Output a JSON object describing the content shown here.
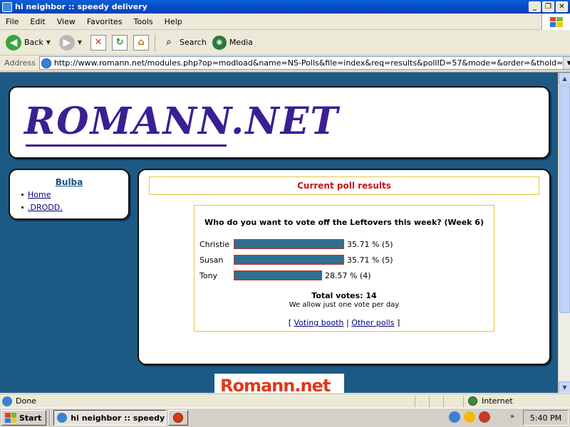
{
  "window": {
    "title": "hi neighbor :: speedy delivery",
    "controls": {
      "minimize": "_",
      "maximize": "❐",
      "close": "✕"
    }
  },
  "menu": [
    "File",
    "Edit",
    "View",
    "Favorites",
    "Tools",
    "Help"
  ],
  "toolbar": {
    "back_label": "Back",
    "search_label": "Search",
    "media_label": "Media"
  },
  "address": {
    "label": "Address",
    "url": "http://www.romann.net/modules.php?op=modload&name=NS-Polls&file=index&req=results&pollID=57&mode=&order=&thold="
  },
  "site": {
    "logo_text": "ROMANN.NET",
    "sidebar": {
      "title": "Bulba",
      "links": [
        "Home",
        ".DRODD."
      ]
    },
    "poll": {
      "heading": "Current poll results",
      "question": "Who do you want to vote off the Leftovers this week? (Week 6)",
      "options": [
        {
          "name": "Christie",
          "percent": 35.71,
          "votes": 5,
          "label": "35.71 % (5)"
        },
        {
          "name": "Susan",
          "percent": 35.71,
          "votes": 5,
          "label": "35.71 % (5)"
        },
        {
          "name": "Tony",
          "percent": 28.57,
          "votes": 4,
          "label": "28.57 % (4)"
        }
      ],
      "total_votes_label": "Total votes: 14",
      "note": "We allow just one vote per day",
      "links": {
        "open": "[",
        "voting_booth": "Voting booth",
        "sep": "|",
        "other_polls": "Other polls",
        "close": "]"
      }
    },
    "banner_text": "Romann.net"
  },
  "status": {
    "text": "Done",
    "zone": "Internet"
  },
  "taskbar": {
    "start_label": "Start",
    "task_label": "hi neighbor :: speedy ...",
    "clock": "5:40 PM"
  },
  "colors": {
    "page_bg": "#1c5a85",
    "poll_bar": "#316d8f",
    "poll_heading": "#cc1212",
    "logo": "#3a1f94"
  }
}
